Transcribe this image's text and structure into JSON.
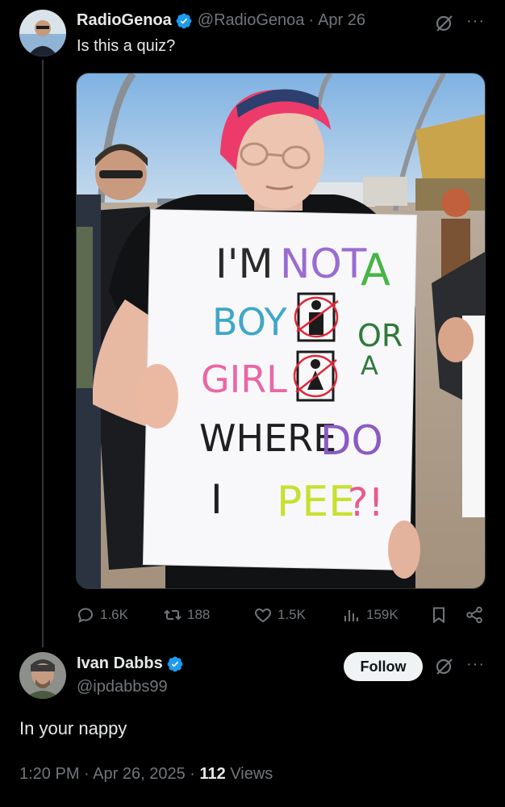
{
  "tweet": {
    "author_name": "RadioGenoa",
    "author_handle": "@RadioGenoa",
    "date": "Apr 26",
    "text": "Is this a quiz?",
    "sign": {
      "line1": [
        "I'M",
        "NOT",
        "A"
      ],
      "line2": [
        "BOY",
        "OR"
      ],
      "line3": [
        "GIRL",
        "A"
      ],
      "line4": [
        "WHERE",
        "DO"
      ],
      "line5": [
        "I",
        "PEE",
        "?!"
      ]
    },
    "stats": {
      "replies": "1.6K",
      "reposts": "188",
      "likes": "1.5K",
      "views": "159K"
    }
  },
  "reply": {
    "author_name": "Ivan Dabbs",
    "author_handle": "@ipdabbs99",
    "follow_label": "Follow",
    "text": "In your nappy",
    "time": "1:20 PM",
    "date": "Apr 26, 2025",
    "views_count": "112",
    "views_label": "Views"
  },
  "colors": {
    "accent": "#1d9bf0",
    "muted": "#71767b",
    "background": "#000000"
  },
  "icons": [
    "verified-badge-icon",
    "grok-icon",
    "more-icon",
    "reply-icon",
    "repost-icon",
    "like-icon",
    "views-icon",
    "bookmark-icon",
    "share-icon"
  ]
}
